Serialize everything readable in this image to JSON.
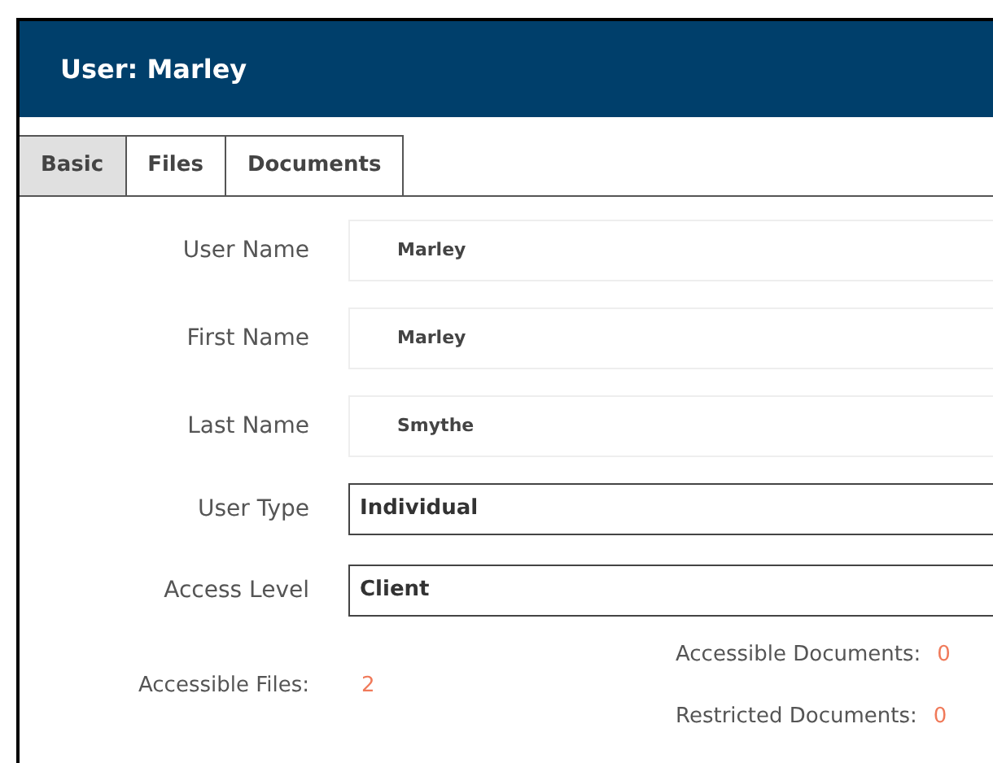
{
  "title": "User: Marley",
  "tabs": [
    {
      "label": "Basic",
      "selected": true
    },
    {
      "label": "Files",
      "selected": false
    },
    {
      "label": "Documents",
      "selected": false
    }
  ],
  "fields": [
    {
      "label": "User Name",
      "kind": "text",
      "value": "Marley"
    },
    {
      "label": "First Name",
      "kind": "text",
      "value": "Marley"
    },
    {
      "label": "Last Name",
      "kind": "text",
      "value": "Smythe"
    },
    {
      "label": "User Type",
      "kind": "select",
      "value": "Individual"
    },
    {
      "label": "Access Level",
      "kind": "select",
      "value": "Client"
    }
  ],
  "stats": {
    "files": {
      "label": "Accessible Files:",
      "value": "2"
    },
    "documents": [
      {
        "label": "Accessible Documents:",
        "value": "0"
      },
      {
        "label": "Restricted Documents:",
        "value": "0"
      }
    ]
  }
}
